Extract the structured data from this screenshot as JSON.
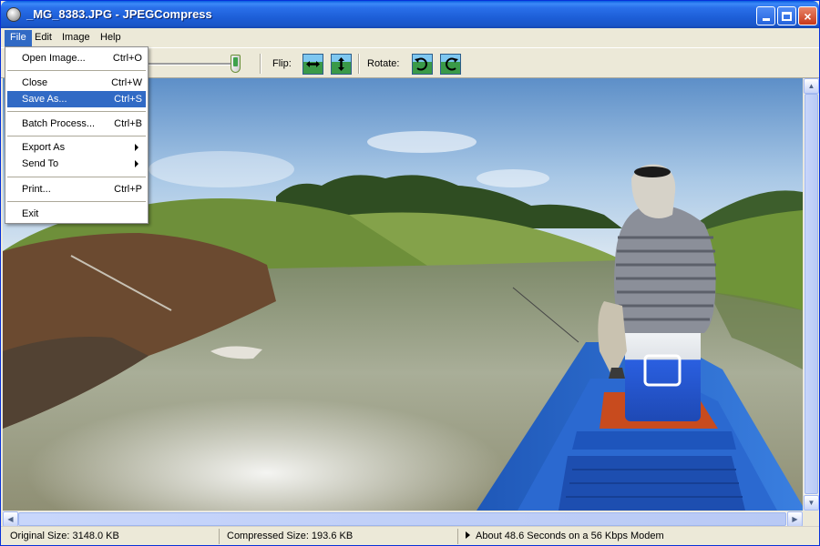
{
  "window": {
    "title": "_MG_8383.JPG - JPEGCompress",
    "icon": "app-icon",
    "controls": {
      "minimize": "minimize-icon",
      "maximize": "maximize-icon",
      "close": "×"
    }
  },
  "menubar": {
    "items": [
      {
        "label": "File"
      },
      {
        "label": "Edit"
      },
      {
        "label": "Image"
      },
      {
        "label": "Help"
      }
    ]
  },
  "toolbar": {
    "flip_label": "Flip:",
    "rotate_label": "Rotate:",
    "quality_level": 0.95
  },
  "file_menu": {
    "items": [
      {
        "label": "Open Image...",
        "shortcut": "Ctrl+O"
      },
      {
        "label": "Close",
        "shortcut": "Ctrl+W"
      },
      {
        "label": "Save As...",
        "shortcut": "Ctrl+S"
      },
      {
        "label": "Batch Process...",
        "shortcut": "Ctrl+B"
      },
      {
        "label": "Export As",
        "submenu": true
      },
      {
        "label": "Send To",
        "submenu": true
      },
      {
        "label": "Print...",
        "shortcut": "Ctrl+P"
      },
      {
        "label": "Exit"
      }
    ],
    "highlighted": "Save As..."
  },
  "statusbar": {
    "original_size": "Original Size: 3148.0 KB",
    "compressed_size": "Compressed Size: 193.6 KB",
    "download_time": "About 48.6 Seconds on a 56 Kbps Modem"
  },
  "colors": {
    "titlebar_blue": "#1d5fd8",
    "menu_highlight": "#316ac5",
    "boat_blue": "#2f6fd2",
    "cooler_blue": "#2a5fe0"
  }
}
